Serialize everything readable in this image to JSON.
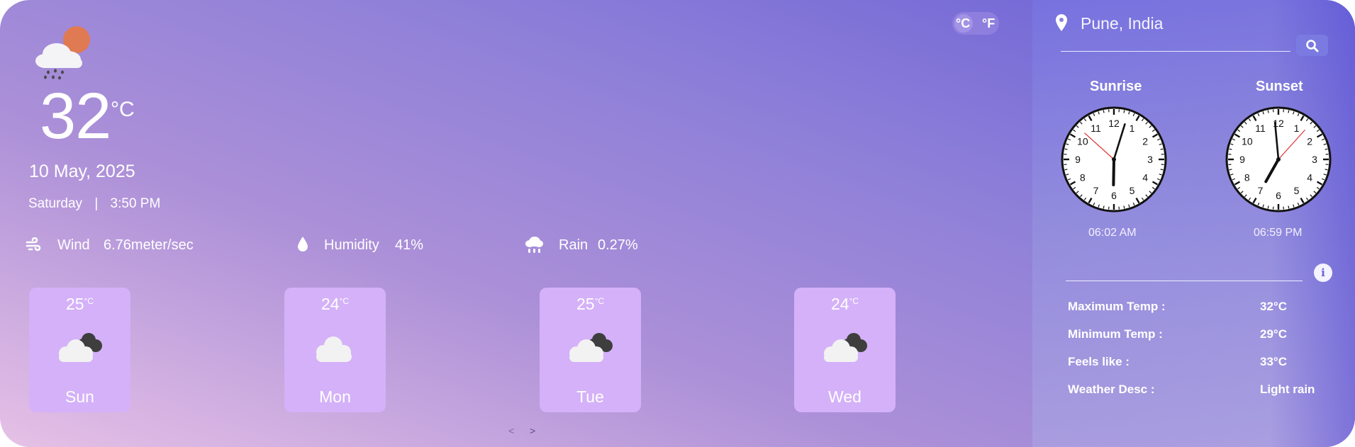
{
  "units": {
    "celsius": "°C",
    "fahrenheit": "°F",
    "selected": "°C"
  },
  "current": {
    "icon": "cloud-rain-sun-icon",
    "temperature": "32",
    "unit": "°C",
    "date": "10 May, 2025",
    "day": "Saturday",
    "separator": "|",
    "time": "3:50 PM"
  },
  "stats": [
    {
      "icon": "wind-icon",
      "label": "Wind",
      "value": "6.76meter/sec"
    },
    {
      "icon": "droplet-icon",
      "label": "Humidity",
      "value": "41%"
    },
    {
      "icon": "rain-cloud-icon",
      "label": "Rain",
      "value": "0.27%"
    }
  ],
  "forecast": [
    {
      "temp": "25",
      "unit": "°C",
      "icon": "partly-cloudy-icon",
      "day": "Sun"
    },
    {
      "temp": "24",
      "unit": "°C",
      "icon": "cloud-icon",
      "day": "Mon"
    },
    {
      "temp": "25",
      "unit": "°C",
      "icon": "partly-cloudy-icon",
      "day": "Tue"
    },
    {
      "temp": "24",
      "unit": "°C",
      "icon": "partly-cloudy-icon",
      "day": "Wed"
    }
  ],
  "pager": {
    "prev": "<",
    "next": ">"
  },
  "sidebar": {
    "location": "Pune, India",
    "sunrise": {
      "title": "Sunrise",
      "time": "06:02 AM"
    },
    "sunset": {
      "title": "Sunset",
      "time": "06:59 PM"
    },
    "details": [
      {
        "label": "Maximum Temp :",
        "value": "32°C"
      },
      {
        "label": "Minimum Temp :",
        "value": "29°C"
      },
      {
        "label": "Feels like :",
        "value": "33°C"
      },
      {
        "label": "Weather Desc :",
        "value": "Light rain"
      }
    ]
  },
  "colors": {
    "card": "#d4b1f8",
    "accent": "#6a5fd6",
    "clock_face": "#ffffff",
    "second_hand": "#e03030"
  }
}
